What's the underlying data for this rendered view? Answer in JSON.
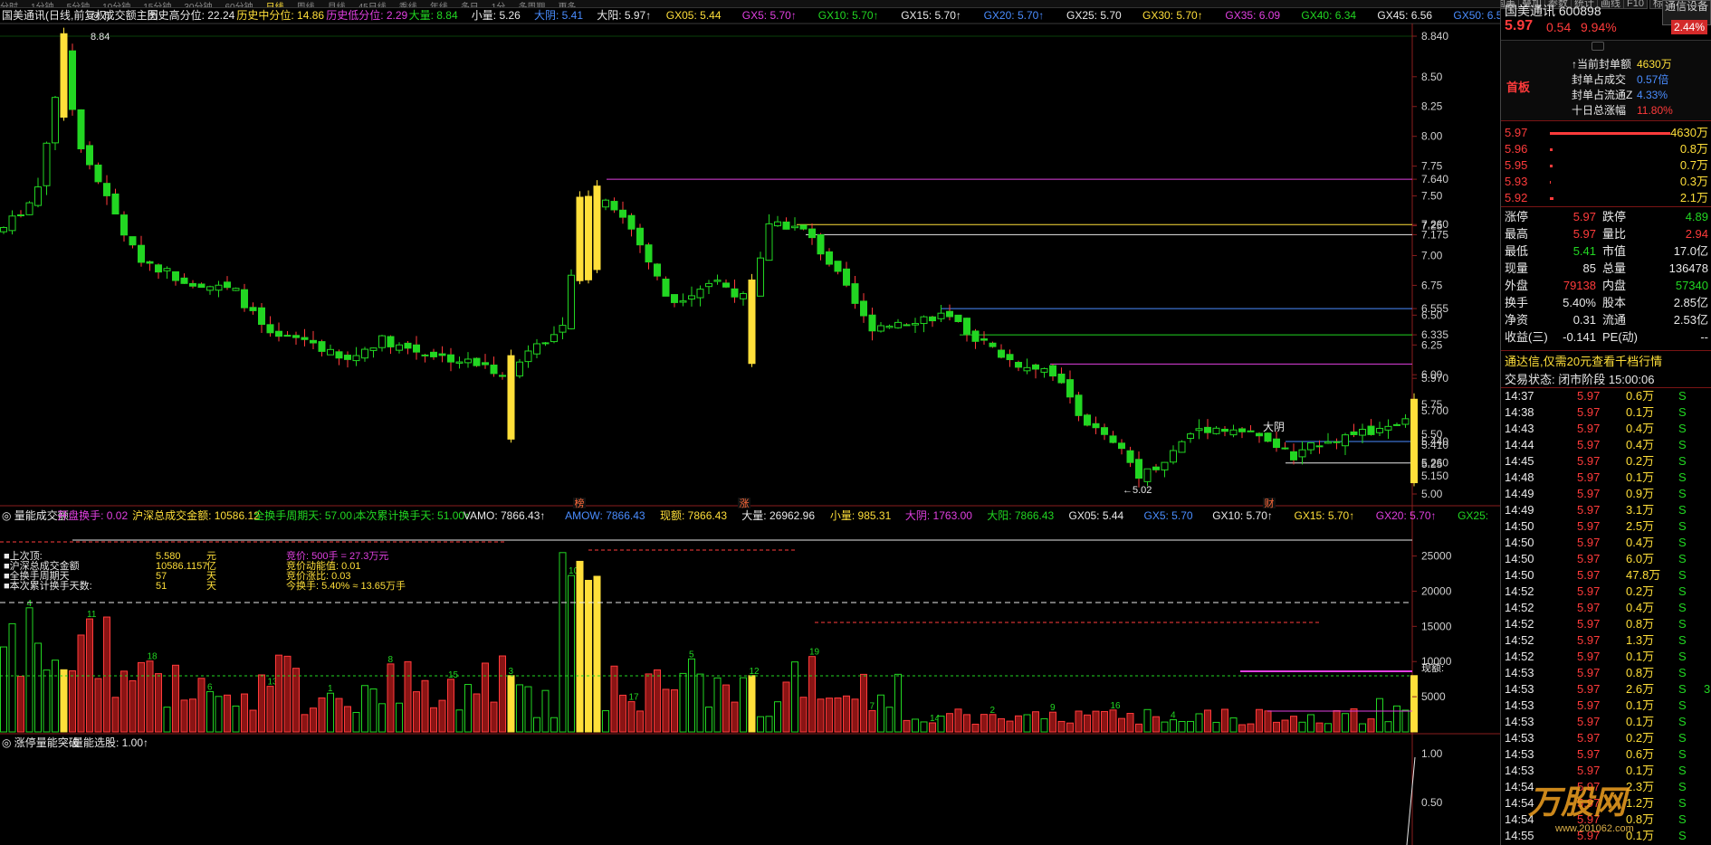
{
  "topbar": {
    "periods": [
      "分时",
      "1分钟",
      "5分钟",
      "10分钟",
      "15分钟",
      "30分钟",
      "60分钟",
      "日线",
      "周线",
      "月线",
      "45日线",
      "季线",
      "年线",
      "多日",
      "1分",
      "多周期",
      "更多"
    ]
  },
  "main_header": {
    "items": [
      {
        "text": "国美通讯(日线,前复权)",
        "color": "#e8e8e8"
      },
      {
        "text": "◎ 成交额主图",
        "color": "#e8e8e8"
      },
      {
        "text": "历史高分位: 22.24",
        "color": "#e8e8e8"
      },
      {
        "text": "历史中分位: 14.86",
        "color": "#ffdf3a"
      },
      {
        "text": "历史低分位: 2.29",
        "color": "#e040e0"
      },
      {
        "text": "大量: 8.84",
        "color": "#22d622"
      },
      {
        "text": "小量: 5.26",
        "color": "#e8e8e8"
      },
      {
        "text": "大阴: 5.41",
        "color": "#4a8dff"
      },
      {
        "text": "大阳: 5.97↑",
        "color": "#e8e8e8"
      },
      {
        "text": "GX05: 5.44",
        "color": "#ffdf3a"
      },
      {
        "text": "GX5: 5.70↑",
        "color": "#e040e0"
      },
      {
        "text": "GX10: 5.70↑",
        "color": "#22d622"
      },
      {
        "text": "GX15: 5.70↑",
        "color": "#e8e8e8"
      },
      {
        "text": "GX20: 5.70↑",
        "color": "#4a8dff"
      },
      {
        "text": "GX25: 5.70",
        "color": "#e8e8e8"
      },
      {
        "text": "GX30: 5.70↑",
        "color": "#ffdf3a"
      },
      {
        "text": "GX35: 6.09",
        "color": "#e040e0"
      },
      {
        "text": "GX40: 6.34",
        "color": "#22d622"
      },
      {
        "text": "GX45: 6.56",
        "color": "#e8e8e8"
      },
      {
        "text": "GX50: 6.56",
        "color": "#4a8dff"
      },
      {
        "text": "GX5",
        "color": "#e8e8e8"
      }
    ]
  },
  "price_axis": {
    "labels": [
      "8.840",
      "8.50",
      "8.25",
      "8.00",
      "7.75",
      "7.640",
      "7.50",
      "7.260",
      "7.25",
      "7.175",
      "7.00",
      "6.75",
      "6.555",
      "6.50",
      "6.335",
      "6.25",
      "6.00",
      "5.970",
      "5.75",
      "5.700",
      "5.50",
      "5.440",
      "5.410",
      "5.260",
      "5.25",
      "5.150",
      "5.00"
    ],
    "values": [
      8.84,
      8.5,
      8.25,
      8.0,
      7.75,
      7.64,
      7.5,
      7.26,
      7.25,
      7.175,
      7.0,
      6.75,
      6.555,
      6.5,
      6.335,
      6.25,
      6.0,
      5.97,
      5.75,
      5.7,
      5.5,
      5.44,
      5.41,
      5.26,
      5.25,
      5.15,
      5.0
    ],
    "high_label": "8.84",
    "low_label": "5.02",
    "dayang_label": "大阴",
    "markers": [
      "榜",
      "涨",
      "财"
    ]
  },
  "volume_header": {
    "items": [
      {
        "text": "◎ 量能成交额",
        "color": "#e8e8e8"
      },
      {
        "text": "开盘换手: 0.02",
        "color": "#e040e0"
      },
      {
        "text": "沪深总成交金额: 10586.12",
        "color": "#ffdf3a"
      },
      {
        "text": "全换手周期天: 57.00↓",
        "color": "#22d622"
      },
      {
        "text": "本次累计换手天: 51.00↑",
        "color": "#22d622"
      },
      {
        "text": "VAMO: 7866.43↑",
        "color": "#e8e8e8"
      },
      {
        "text": "AMOW: 7866.43",
        "color": "#4a8dff"
      },
      {
        "text": "现额: 7866.43",
        "color": "#ffdf3a"
      },
      {
        "text": "大量: 26962.96",
        "color": "#e8e8e8"
      },
      {
        "text": "小量: 985.31",
        "color": "#ffdf3a"
      },
      {
        "text": "大阴: 1763.00",
        "color": "#e040e0"
      },
      {
        "text": "大阳: 7866.43",
        "color": "#22d622"
      },
      {
        "text": "GX05: 5.44",
        "color": "#e8e8e8"
      },
      {
        "text": "GX5: 5.70",
        "color": "#4a8dff"
      },
      {
        "text": "GX10: 5.70↑",
        "color": "#e8e8e8"
      },
      {
        "text": "GX15: 5.70↑",
        "color": "#ffdf3a"
      },
      {
        "text": "GX20: 5.70↑",
        "color": "#e040e0"
      },
      {
        "text": "GX25:",
        "color": "#22d622"
      }
    ],
    "axis_labels": [
      "25000",
      "20000",
      "15000",
      "10000",
      "5000"
    ],
    "axis_values": [
      25000,
      20000,
      15000,
      10000,
      5000
    ],
    "info_left": [
      "上次顶:",
      "沪深总成交金额",
      "全换手周期天",
      "本次累计换手天数:"
    ],
    "info_mid": [
      "5.580",
      "10586.1157",
      "57",
      "51"
    ],
    "info_unit": [
      "元",
      "亿",
      "天",
      "天"
    ],
    "info_right": [
      "竞价: 500手 = 27.3万元",
      "竞价动能值: 0.01",
      "竞价涨比: 0.03",
      "今换手: 5.40% ≈ 13.65万手"
    ],
    "xianxe_label": "现额:"
  },
  "bottom_header": {
    "items": [
      {
        "text": "◎ 涨停量能突破",
        "color": "#e8e8e8"
      },
      {
        "text": "量能选股: 1.00↑",
        "color": "#e8e8e8"
      }
    ],
    "axis_labels": [
      "1.00",
      "0.50"
    ]
  },
  "watermark": {
    "text": "万股网",
    "sub": "www.201062.com"
  },
  "right_panel": {
    "tabs": [
      "国美",
      "叠加",
      "参数",
      "统计",
      "画线",
      "F10",
      "标记",
      "返回"
    ],
    "top_buttons": [
      "通信设备"
    ],
    "stock_name": "国美通讯 600898",
    "price": "5.97",
    "change": "0.54",
    "change_pct": "9.94%",
    "sector_pct": "2.44%",
    "section_tag": "首板",
    "seal_info": [
      {
        "label": "↑当前封单额",
        "value": "4630万",
        "color": "#ffdf3a"
      },
      {
        "label": "封单占成交",
        "value": "0.57倍",
        "color": "#4a8dff"
      },
      {
        "label": "封单占流通Z",
        "value": "4.33%",
        "color": "#4a8dff"
      },
      {
        "label": "十日总涨幅",
        "value": "11.80%",
        "color": "#ff3b3b"
      }
    ],
    "order_book": [
      {
        "price": "5.97",
        "vol": "4630万",
        "bar": 0.95
      },
      {
        "price": "5.96",
        "vol": "0.8万",
        "bar": 0.02
      },
      {
        "price": "5.95",
        "vol": "0.7万",
        "bar": 0.02
      },
      {
        "price": "5.93",
        "vol": "0.3万",
        "bar": 0.01
      },
      {
        "price": "5.92",
        "vol": "2.1万",
        "bar": 0.03
      }
    ],
    "quote": [
      {
        "l": "涨停",
        "lv": "5.97",
        "lc": "#ff3b3b",
        "r": "跌停",
        "rv": "4.89",
        "rc": "#22d622"
      },
      {
        "l": "最高",
        "lv": "5.97",
        "lc": "#ff3b3b",
        "r": "量比",
        "rv": "2.94",
        "rc": "#ff3b3b"
      },
      {
        "l": "最低",
        "lv": "5.41",
        "lc": "#22d622",
        "r": "市值",
        "rv": "17.0亿",
        "rc": "#e8e8e8"
      },
      {
        "l": "现量",
        "lv": "85",
        "lc": "#e8e8e8",
        "r": "总量",
        "rv": "136478",
        "rc": "#e8e8e8"
      },
      {
        "l": "外盘",
        "lv": "79138",
        "lc": "#ff3b3b",
        "r": "内盘",
        "rv": "57340",
        "rc": "#22d622"
      },
      {
        "l": "换手",
        "lv": "5.40%",
        "lc": "#e8e8e8",
        "r": "股本",
        "rv": "2.85亿",
        "rc": "#e8e8e8"
      },
      {
        "l": "净资",
        "lv": "0.31",
        "lc": "#e8e8e8",
        "r": "流通",
        "rv": "2.53亿",
        "rc": "#e8e8e8"
      },
      {
        "l": "收益(三)",
        "lv": "-0.141",
        "lc": "#e8e8e8",
        "r": "PE(动)",
        "rv": "--",
        "rc": "#e8e8e8"
      }
    ],
    "promo": "通达信,仅需20元查看千档行情",
    "trade_status": "交易状态: 闭市阶段 15:00:06",
    "ticks": [
      [
        "14:37",
        "5.97",
        "0.6万",
        "S"
      ],
      [
        "14:38",
        "5.97",
        "0.1万",
        "S"
      ],
      [
        "14:43",
        "5.97",
        "0.4万",
        "S"
      ],
      [
        "14:44",
        "5.97",
        "0.4万",
        "S"
      ],
      [
        "14:45",
        "5.97",
        "0.2万",
        "S"
      ],
      [
        "14:48",
        "5.97",
        "0.1万",
        "S"
      ],
      [
        "14:49",
        "5.97",
        "0.9万",
        "S"
      ],
      [
        "14:49",
        "5.97",
        "3.1万",
        "S"
      ],
      [
        "14:50",
        "5.97",
        "2.5万",
        "S"
      ],
      [
        "14:50",
        "5.97",
        "0.4万",
        "S"
      ],
      [
        "14:50",
        "5.97",
        "6.0万",
        "S"
      ],
      [
        "14:50",
        "5.97",
        "47.8万",
        "S"
      ],
      [
        "14:52",
        "5.97",
        "0.2万",
        "S"
      ],
      [
        "14:52",
        "5.97",
        "0.4万",
        "S"
      ],
      [
        "14:52",
        "5.97",
        "0.8万",
        "S"
      ],
      [
        "14:52",
        "5.97",
        "1.3万",
        "S"
      ],
      [
        "14:52",
        "5.97",
        "0.1万",
        "S"
      ],
      [
        "14:53",
        "5.97",
        "0.8万",
        "S"
      ],
      [
        "14:53",
        "5.97",
        "2.6万",
        "S"
      ],
      [
        "14:53",
        "5.97",
        "0.1万",
        "S"
      ],
      [
        "14:53",
        "5.97",
        "0.1万",
        "S"
      ],
      [
        "14:53",
        "5.97",
        "0.2万",
        "S"
      ],
      [
        "14:53",
        "5.97",
        "0.6万",
        "S"
      ],
      [
        "14:53",
        "5.97",
        "0.1万",
        "S"
      ],
      [
        "14:54",
        "5.97",
        "2.3万",
        "S"
      ],
      [
        "14:54",
        "5.97",
        "1.2万",
        "S"
      ],
      [
        "14:54",
        "5.97",
        "0.8万",
        "S"
      ],
      [
        "14:55",
        "5.97",
        "0.1万",
        "S"
      ]
    ],
    "tick_tail": [
      "",
      "",
      "",
      "",
      "",
      "",
      "",
      "",
      "",
      "",
      "",
      "",
      "",
      "",
      "",
      "",
      "",
      "",
      "3",
      "",
      "",
      "",
      "",
      "",
      "",
      "",
      "",
      ""
    ]
  }
}
